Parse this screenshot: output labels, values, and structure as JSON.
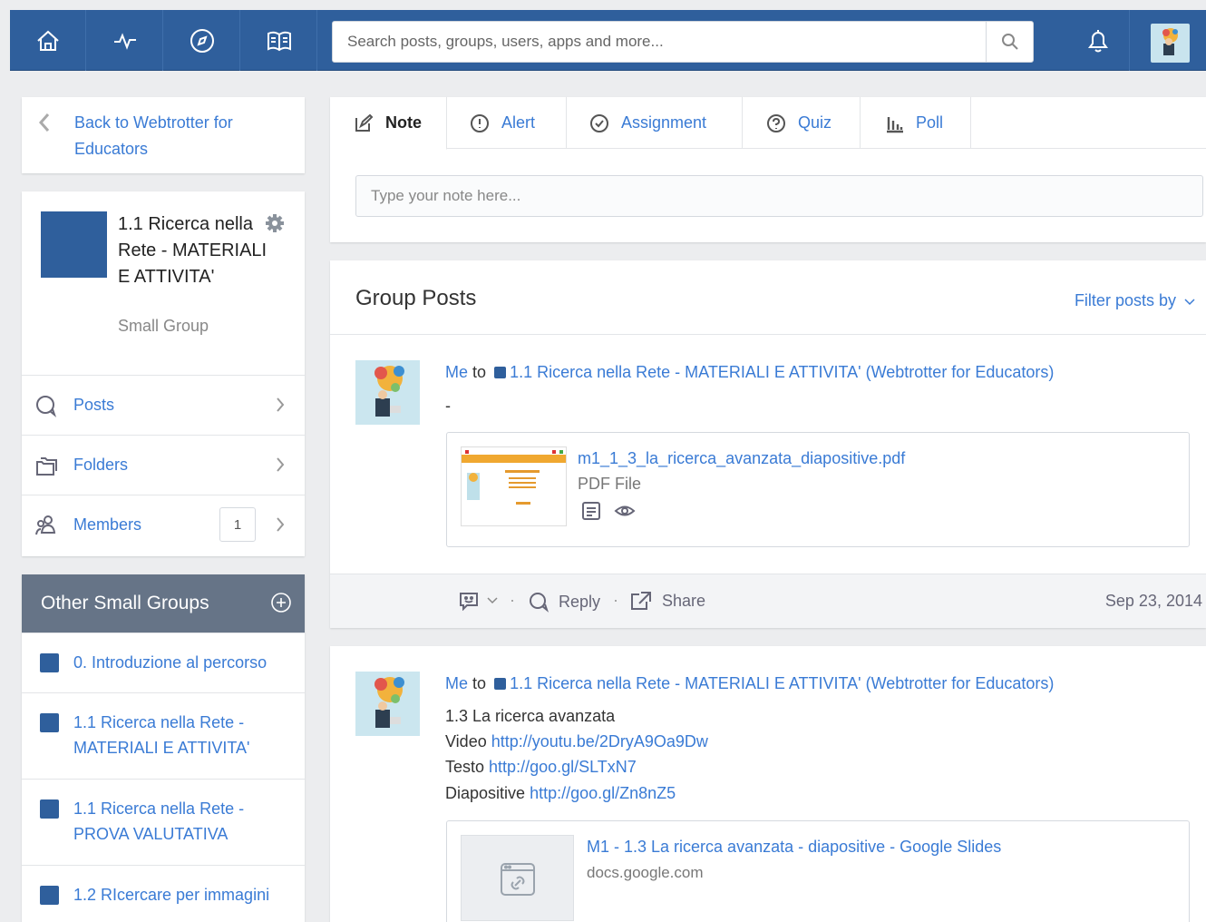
{
  "topbar": {
    "search_placeholder": "Search posts, groups, users, apps and more...",
    "nav_icons": [
      "home-icon",
      "activity-icon",
      "compass-icon",
      "book-icon"
    ]
  },
  "sidebar": {
    "back_label": "Back to Webtrotter for Educators",
    "group_name": "1.1 Ricerca nella Rete - MATERIALI E ATTIVITA'",
    "group_type": "Small Group",
    "menu": [
      {
        "label": "Posts",
        "icon": "speech-bubble-icon"
      },
      {
        "label": "Folders",
        "icon": "folders-icon"
      },
      {
        "label": "Members",
        "icon": "members-icon",
        "count": "1"
      }
    ],
    "other_groups_title": "Other Small Groups",
    "other_groups": [
      {
        "label": "0. Introduzione al percorso"
      },
      {
        "label": "1.1 Ricerca nella Rete - MATERIALI E ATTIVITA'"
      },
      {
        "label": "1.1 Ricerca nella Rete - PROVA VALUTATIVA"
      },
      {
        "label": "1.2 RIcercare per immagini"
      }
    ]
  },
  "composer": {
    "tabs": [
      {
        "label": "Note",
        "icon": "edit-icon",
        "active": true
      },
      {
        "label": "Alert",
        "icon": "alert-icon"
      },
      {
        "label": "Assignment",
        "icon": "check-circle-icon"
      },
      {
        "label": "Quiz",
        "icon": "question-circle-icon"
      },
      {
        "label": "Poll",
        "icon": "bar-chart-icon"
      }
    ],
    "note_placeholder": "Type your note here..."
  },
  "posts": {
    "title": "Group Posts",
    "filter_label": "Filter posts by",
    "items": [
      {
        "sender": "Me",
        "to_word": "to",
        "group": "1.1 Ricerca nella Rete - MATERIALI E ATTIVITA' (Webtrotter for Educators)",
        "body": "-",
        "attachment": {
          "name": "m1_1_3_la_ricerca_avanzata_diapositive.pdf",
          "type": "PDF File"
        },
        "actions": {
          "reply": "Reply",
          "share": "Share"
        },
        "date": "Sep 23, 2014"
      },
      {
        "sender": "Me",
        "to_word": "to",
        "group": "1.1 Ricerca nella Rete - MATERIALI E ATTIVITA' (Webtrotter for Educators)",
        "lines": [
          {
            "text": "1.3 La ricerca avanzata",
            "link": ""
          },
          {
            "text": "Video",
            "link": "http://youtu.be/2DryA9Oa9Dw"
          },
          {
            "text": "Testo",
            "link": "http://goo.gl/SLTxN7"
          },
          {
            "text": "Diapositive",
            "link": "http://goo.gl/Zn8nZ5"
          }
        ],
        "link_preview": {
          "title": "M1 - 1.3 La ricerca avanzata - diapositive - Google Slides",
          "domain": "docs.google.com"
        }
      }
    ]
  },
  "colors": {
    "topbar": "#2f5f9c",
    "link": "#3a7bd5",
    "other_groups_header": "#667487"
  }
}
